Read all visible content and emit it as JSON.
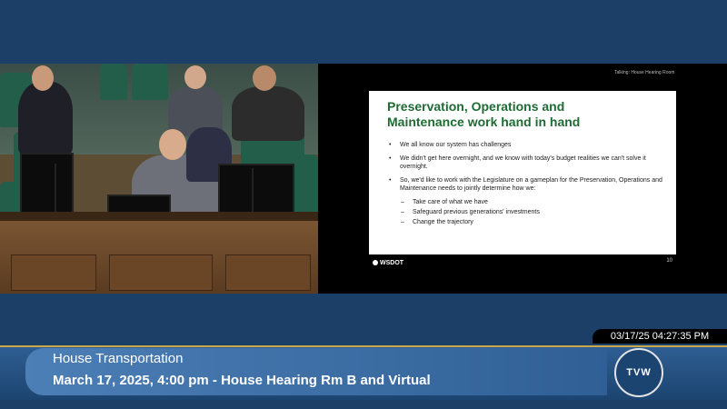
{
  "video_left": {
    "description_hidden": ""
  },
  "slide": {
    "room_label": "Talking: House Hearing Room",
    "title_line1": "Preservation, Operations and",
    "title_line2": "Maintenance work hand in hand",
    "bullets": [
      "We all know our system has challenges",
      "We didn't get here overnight, and we know with today's budget realities we can't solve it overnight.",
      "So, we'd like to work with the Legislature on a gameplan for the Preservation, Operations and Maintenance needs to jointly determine how we:"
    ],
    "sub_bullets": [
      "Take care of what we have",
      "Safeguard previous generations' investments",
      "Change the trajectory"
    ],
    "footer_logo": "WSDOT",
    "page_number": "10"
  },
  "overlay": {
    "timestamp": "03/17/25 04:27:35 PM",
    "program_title": "House Transportation",
    "program_subtitle": "March 17, 2025, 4:00 pm - House Hearing Rm B and Virtual",
    "logo_text": "TVW"
  },
  "colors": {
    "background": "#1b3f66",
    "slide_title": "#1f6b34",
    "bar_border": "#c9a84c"
  }
}
